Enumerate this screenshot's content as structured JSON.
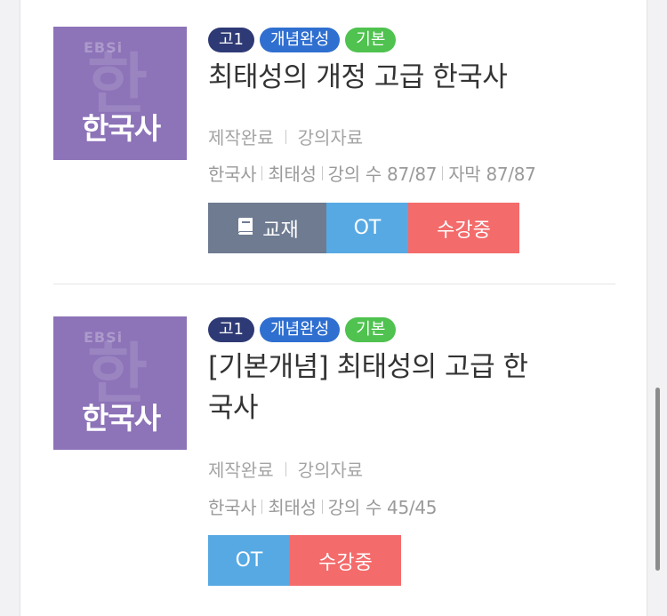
{
  "courses": [
    {
      "thumbnail": {
        "logo": "EBSi",
        "watermark": "한",
        "subject": "한국사"
      },
      "tags": {
        "grade": "고1",
        "level": "개념완성",
        "basic": "기본"
      },
      "title": "최태성의 개정 고급 한국사",
      "status": {
        "production": "제작완료",
        "material": "강의자료"
      },
      "meta": {
        "subject": "한국사",
        "teacher": "최태성",
        "lectures": "강의 수 87/87",
        "subtitles": "자막 87/87"
      },
      "buttons": {
        "textbook": "교재",
        "ot": "OT",
        "enroll": "수강중"
      }
    },
    {
      "thumbnail": {
        "logo": "EBSi",
        "watermark": "한",
        "subject": "한국사"
      },
      "tags": {
        "grade": "고1",
        "level": "개념완성",
        "basic": "기본"
      },
      "title": "[기본개념] 최태성의 고급 한국사",
      "status": {
        "production": "제작완료",
        "material": "강의자료"
      },
      "meta": {
        "subject": "한국사",
        "teacher": "최태성",
        "lectures": "강의 수 45/45"
      },
      "buttons": {
        "ot": "OT",
        "enroll": "수강중"
      }
    }
  ],
  "icons": {
    "textbook": "book-icon"
  },
  "colors": {
    "thumbnail": "#8d73b8",
    "tag_grade": "#2e3a75",
    "tag_level": "#2f6fd0",
    "tag_basic": "#4fc24f",
    "btn_textbook": "#6e7b91",
    "btn_ot": "#57a9e3",
    "btn_enroll": "#f46b6b"
  }
}
